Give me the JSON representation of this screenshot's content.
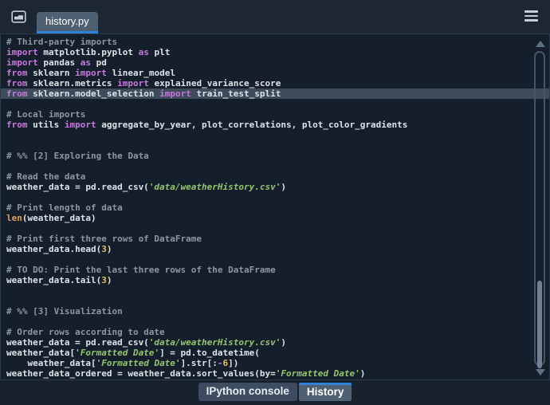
{
  "topbar": {
    "file_tab": "history.py",
    "icons": {
      "left_button": "folder-icon",
      "right_button": "hamburger-menu-icon"
    }
  },
  "colors": {
    "accent_blue": "#2f82d8",
    "topbar_bg": "#1d2734",
    "editor_bg": "#151f2b",
    "active_tab_bg": "#4e6173",
    "current_line_bg": "#3e4b5a",
    "keyword": "#c678dd",
    "comment": "#8c97a3",
    "string": "#93c571",
    "number": "#e3c05f",
    "builtin": "#dd9e5f"
  },
  "editor": {
    "lines": [
      {
        "t": [
          [
            "com",
            "# Third-party imports"
          ]
        ]
      },
      {
        "t": [
          [
            "kw",
            "import"
          ],
          [
            "tx",
            " matplotlib.pyplot "
          ],
          [
            "kw",
            "as"
          ],
          [
            "tx",
            " plt"
          ]
        ]
      },
      {
        "t": [
          [
            "kw",
            "import"
          ],
          [
            "tx",
            " pandas "
          ],
          [
            "kw",
            "as"
          ],
          [
            "tx",
            " pd"
          ]
        ]
      },
      {
        "t": [
          [
            "kw",
            "from"
          ],
          [
            "tx",
            " sklearn "
          ],
          [
            "kw",
            "import"
          ],
          [
            "tx",
            " linear_model"
          ]
        ]
      },
      {
        "t": [
          [
            "kw",
            "from"
          ],
          [
            "tx",
            " sklearn.metrics "
          ],
          [
            "kw",
            "import"
          ],
          [
            "tx",
            " explained_variance_score"
          ]
        ]
      },
      {
        "hl": true,
        "t": [
          [
            "kw",
            "from"
          ],
          [
            "tx",
            " sklearn.model_selection "
          ],
          [
            "kw",
            "import"
          ],
          [
            "tx",
            " train_test_split"
          ]
        ]
      },
      {},
      {
        "t": [
          [
            "com",
            "# Local imports"
          ]
        ]
      },
      {
        "t": [
          [
            "kw",
            "from"
          ],
          [
            "tx",
            " utils "
          ],
          [
            "kw",
            "import"
          ],
          [
            "tx",
            " aggregate_by_year, plot_correlations, plot_color_gradients"
          ]
        ]
      },
      {},
      {},
      {
        "t": [
          [
            "com",
            "# %% [2] Exploring the Data"
          ]
        ]
      },
      {},
      {
        "t": [
          [
            "com",
            "# Read the data"
          ]
        ]
      },
      {
        "t": [
          [
            "tx",
            "weather_data = pd.read_csv("
          ],
          [
            "str",
            "'data/weatherHistory.csv'"
          ],
          [
            "tx",
            ")"
          ]
        ]
      },
      {},
      {
        "t": [
          [
            "com",
            "# Print length of data"
          ]
        ]
      },
      {
        "t": [
          [
            "bi",
            "len"
          ],
          [
            "tx",
            "(weather_data)"
          ]
        ]
      },
      {},
      {
        "t": [
          [
            "com",
            "# Print first three rows of DataFrame"
          ]
        ]
      },
      {
        "t": [
          [
            "tx",
            "weather_data.head("
          ],
          [
            "num",
            "3"
          ],
          [
            "tx",
            ")"
          ]
        ]
      },
      {},
      {
        "t": [
          [
            "com",
            "# TO DO: Print the last three rows of the DataFrame"
          ]
        ]
      },
      {
        "t": [
          [
            "tx",
            "weather_data.tail("
          ],
          [
            "num",
            "3"
          ],
          [
            "tx",
            ")"
          ]
        ]
      },
      {},
      {},
      {
        "t": [
          [
            "com",
            "# %% [3] Visualization"
          ]
        ]
      },
      {},
      {
        "t": [
          [
            "com",
            "# Order rows according to date"
          ]
        ]
      },
      {
        "t": [
          [
            "tx",
            "weather_data = pd.read_csv("
          ],
          [
            "str",
            "'data/weatherHistory.csv'"
          ],
          [
            "tx",
            ")"
          ]
        ]
      },
      {
        "t": [
          [
            "tx",
            "weather_data["
          ],
          [
            "str",
            "'Formatted Date'"
          ],
          [
            "tx",
            "] = pd.to_datetime("
          ]
        ]
      },
      {
        "t": [
          [
            "tx",
            "    weather_data["
          ],
          [
            "str",
            "'Formatted Date'"
          ],
          [
            "tx",
            "].str[:"
          ],
          [
            "kw",
            "-"
          ],
          [
            "num",
            "6"
          ],
          [
            "tx",
            "])"
          ]
        ]
      },
      {
        "t": [
          [
            "tx",
            "weather_data_ordered = weather_data.sort_values(by="
          ],
          [
            "str",
            "'Formatted Date'"
          ],
          [
            "tx",
            ")"
          ]
        ]
      }
    ]
  },
  "bottombar": {
    "tabs": [
      {
        "label": "IPython console",
        "active": false
      },
      {
        "label": "History",
        "active": true
      }
    ]
  }
}
